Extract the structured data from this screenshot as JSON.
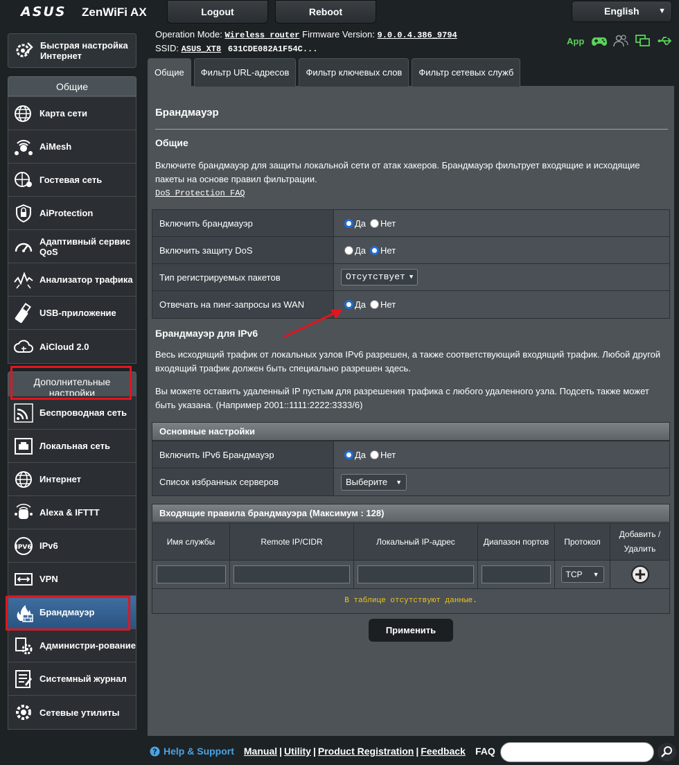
{
  "header": {
    "brand": "ASUS",
    "model": "ZenWiFi AX",
    "logout": "Logout",
    "reboot": "Reboot",
    "language": "English"
  },
  "info": {
    "op_mode_label": "Operation Mode:",
    "op_mode_value": "Wireless router",
    "fw_label": "Firmware Version:",
    "fw_value": "9.0.0.4.386_9794",
    "ssid_label": "SSID:",
    "ssid1": "ASUS_XT8",
    "ssid2": "631CDE082A1F54C...",
    "app_label": "App"
  },
  "sidebar": {
    "quick": "Быстрая настройка Интернет",
    "general_title": "Общие",
    "general": [
      "Карта сети",
      "AiMesh",
      "Гостевая сеть",
      "AiProtection",
      "Адаптивный сервис QoS",
      "Анализатор трафика",
      "USB-приложение",
      "AiCloud 2.0"
    ],
    "advanced_title": "Дополнительные настройки",
    "advanced": [
      "Беспроводная сеть",
      "Локальная сеть",
      "Интернет",
      "Alexa & IFTTT",
      "IPv6",
      "VPN",
      "Брандмауэр",
      "Администри-рование",
      "Системный журнал",
      "Сетевые утилиты"
    ]
  },
  "tabs": [
    "Общие",
    "Фильтр URL-адресов",
    "Фильтр ключевых слов",
    "Фильтр сетевых служб"
  ],
  "main": {
    "title": "Брандмауэр",
    "general_sub": "Общие",
    "general_desc": "Включите брандмауэр для защиты локальной сети от атак хакеров. Брандмауэр фильтрует входящие и исходящие пакеты на основе правил фильтрации.",
    "faq_link": "DoS Protection FAQ",
    "rows": [
      {
        "label": "Включить брандмауэр",
        "yes": "Да",
        "no": "Нет",
        "selected": "yes"
      },
      {
        "label": "Включить защиту DoS",
        "yes": "Да",
        "no": "Нет",
        "selected": "no"
      },
      {
        "label": "Тип регистрируемых пакетов",
        "select": "Отсутствует"
      },
      {
        "label": "Отвечать на пинг-запросы из WAN",
        "yes": "Да",
        "no": "Нет",
        "selected": "yes"
      }
    ],
    "ipv6_sub": "Брандмауэр для IPv6",
    "ipv6_desc1": "Весь исходящий трафик от локальных узлов IPv6 разрешен, а также соответствующий входящий трафик. Любой другой входящий трафик должен быть специально разрешен здесь.",
    "ipv6_desc2": "Вы можете оставить удаленный IP пустым для разрешения трафика с любого удаленного узла. Подсеть также может быть указана. (Например 2001::1111:2222:3333/6)",
    "basic_head": "Основные настройки",
    "ipv6_rows": [
      {
        "label": "Включить IPv6 Брандмауэр",
        "yes": "Да",
        "no": "Нет"
      },
      {
        "label": "Список избранных серверов",
        "select": "Выберите"
      }
    ],
    "rules_head": "Входящие правила брандмауэра (Максимум : 128)",
    "rules_cols": [
      "Имя службы",
      "Remote IP/CIDR",
      "Локальный IP-адрес",
      "Диапазон портов",
      "Протокол",
      "Добавить / Удалить"
    ],
    "protocol": "TCP",
    "empty": "В таблице отсутствуют данные.",
    "apply": "Применить"
  },
  "footer": {
    "help": "Help & Support",
    "manual": "Manual",
    "utility": "Utility",
    "registration": "Product Registration",
    "feedback": "Feedback",
    "faq": "FAQ"
  },
  "colors": {
    "accent": "#1e6fd9",
    "highlight": "#e0161f",
    "empty_text": "#f5c518"
  }
}
